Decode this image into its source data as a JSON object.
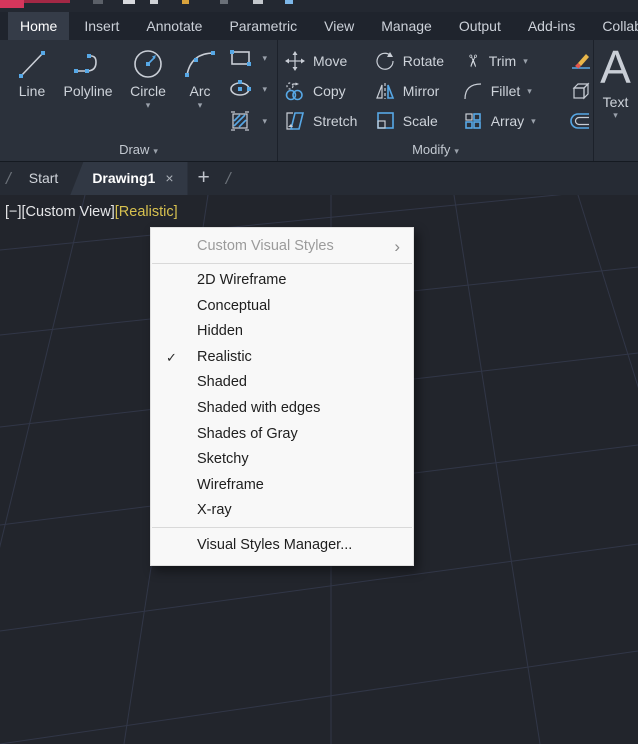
{
  "ribbon": {
    "tabs": [
      {
        "label": "Home",
        "active": true
      },
      {
        "label": "Insert",
        "active": false
      },
      {
        "label": "Annotate",
        "active": false
      },
      {
        "label": "Parametric",
        "active": false
      },
      {
        "label": "View",
        "active": false
      },
      {
        "label": "Manage",
        "active": false
      },
      {
        "label": "Output",
        "active": false
      },
      {
        "label": "Add-ins",
        "active": false
      },
      {
        "label": "Collab",
        "active": false
      }
    ],
    "draw_panel": {
      "label": "Draw",
      "tools": {
        "line": "Line",
        "polyline": "Polyline",
        "circle": "Circle",
        "arc": "Arc"
      }
    },
    "modify_panel": {
      "label": "Modify",
      "tools": {
        "move": "Move",
        "rotate": "Rotate",
        "trim": "Trim",
        "copy": "Copy",
        "mirror": "Mirror",
        "fillet": "Fillet",
        "stretch": "Stretch",
        "scale": "Scale",
        "array": "Array"
      }
    },
    "text_panel": {
      "label": "Text",
      "big_letter": "A"
    },
    "dropdown_glyph": "▾"
  },
  "file_tabs": {
    "start_label": "Start",
    "active_label": "Drawing1",
    "close_glyph": "×",
    "new_tab_glyph": "+",
    "separator_glyph": "/"
  },
  "viewport": {
    "minimize_control": "[−]",
    "view_control": "[Custom View]",
    "style_control": "[Realistic]"
  },
  "menu": {
    "header": "Custom Visual Styles",
    "submenu_arrow": "›",
    "checkmark": "✓",
    "items": [
      {
        "label": "2D Wireframe",
        "checked": false
      },
      {
        "label": "Conceptual",
        "checked": false
      },
      {
        "label": "Hidden",
        "checked": false
      },
      {
        "label": "Realistic",
        "checked": true
      },
      {
        "label": "Shaded",
        "checked": false
      },
      {
        "label": "Shaded with edges",
        "checked": false
      },
      {
        "label": "Shades of Gray",
        "checked": false
      },
      {
        "label": "Sketchy",
        "checked": false
      },
      {
        "label": "Wireframe",
        "checked": false
      },
      {
        "label": "X-ray",
        "checked": false
      }
    ],
    "footer": "Visual Styles Manager..."
  },
  "colors": {
    "accent_blue": "#57a8e6",
    "highlight_yellow": "#d7c14f",
    "menu_bg": "#f8f8f8",
    "ribbon_bg": "#2b313b",
    "viewport_bg": "#22252c",
    "logo_red": "#d6365c"
  }
}
